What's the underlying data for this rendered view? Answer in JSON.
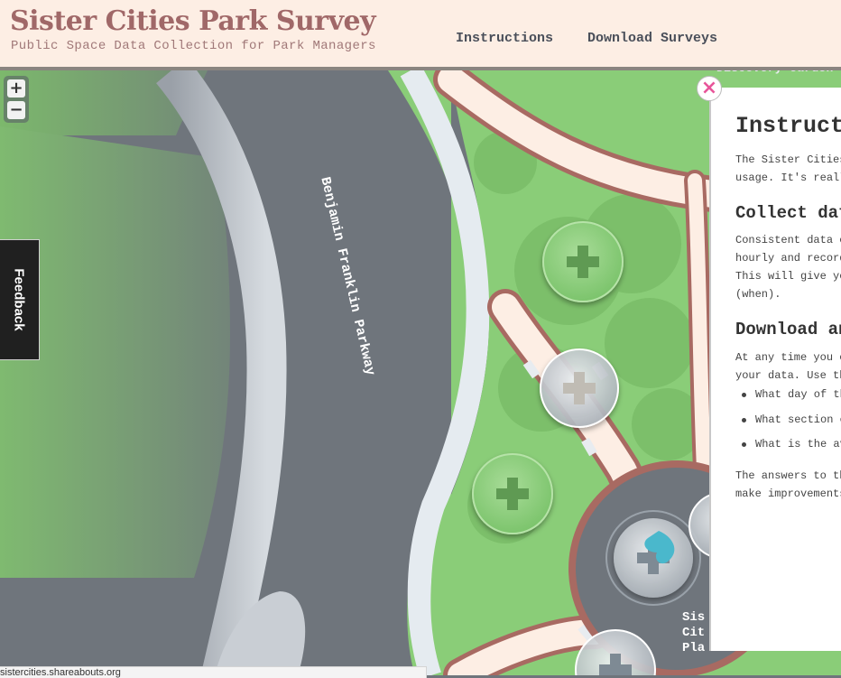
{
  "header": {
    "title": "Sister Cities Park Survey",
    "subtitle": "Public Space Data Collection for Park Managers",
    "nav": [
      {
        "label": "Instructions"
      },
      {
        "label": "Download Surveys"
      }
    ]
  },
  "map": {
    "zoom_in_label": "+",
    "zoom_out_label": "−",
    "feedback_label": "Feedback",
    "street_label": "Benjamin Franklin Parkway",
    "garden_label": "Discovery Garden",
    "plaza_label_lines": [
      "Sis",
      "Cit",
      "Pla"
    ],
    "colors": {
      "road": "#6f757c",
      "grass": "#8acd78",
      "path": "#fdeee4",
      "path_edge": "#a86a62",
      "marker_green": "#8fd080",
      "marker_blue": "#4ab8cc"
    }
  },
  "panel": {
    "close_label": "×",
    "title": "Instructions",
    "intro": [
      "The Sister Cities",
      "usage. It's reall"
    ],
    "collect_heading": "Collect dat",
    "collect_text": [
      "Consistent data c",
      "hourly and record",
      "This will give yo",
      "(when)."
    ],
    "download_heading": "Download an",
    "download_text": [
      "At any time you c",
      "your data. Use th"
    ],
    "questions": [
      "What day of th",
      "What section o",
      "What is the av"
    ],
    "outro": [
      "The answers to th",
      "make improvements"
    ]
  },
  "status_bar": "sistercities.shareabouts.org"
}
